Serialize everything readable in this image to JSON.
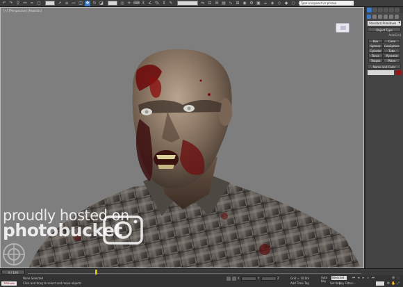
{
  "search": {
    "placeholder": "Type a keyword or phrase"
  },
  "viewport": {
    "label": "[+] [Perspective] [Realistic]"
  },
  "watermark": {
    "line1": "proudly hosted on",
    "line2": "photobucket"
  },
  "command_panel": {
    "dropdown": "Standard Primitives",
    "object_type_label": "Object Type",
    "autogrid_label": "AutoGrid",
    "buttons": [
      "Box",
      "Cone",
      "Sphere",
      "GeoSphere",
      "Cylinder",
      "Tube",
      "Torus",
      "Pyramid",
      "Teapot",
      "Plane"
    ],
    "name_color_label": "Name and Color",
    "object_color": "#9a1414"
  },
  "timeline": {
    "frame_readout": "0 / 100"
  },
  "status": {
    "badge": "3DStudio",
    "line1": "None Selected",
    "line2": "Click and drag to select and move objects",
    "grid": "Grid = 10,0m",
    "add_time_tag": "Add Time Tag",
    "auto_key": "Auto Key",
    "selected": "Selected",
    "set_key": "Set Key",
    "key_filters": "Key Filters..."
  },
  "colors": {
    "viewport_bg": "#7e7e7e",
    "accent": "#3a78c8",
    "key_marker": "#d6c800"
  }
}
